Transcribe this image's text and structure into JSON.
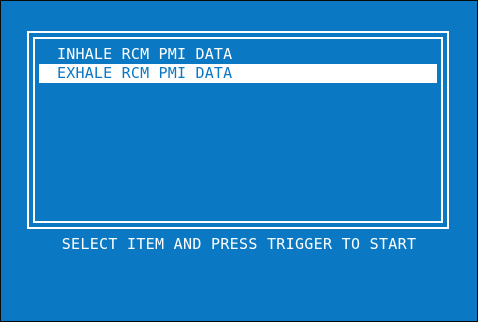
{
  "screen": {
    "background_color": "#0a78c3",
    "foreground_color": "#ffffff"
  },
  "menu": {
    "items": [
      {
        "label": "INHALE RCM PMI DATA",
        "selected": false
      },
      {
        "label": "EXHALE RCM PMI DATA",
        "selected": true
      }
    ]
  },
  "footer": {
    "instruction": "SELECT ITEM AND PRESS TRIGGER TO START"
  }
}
